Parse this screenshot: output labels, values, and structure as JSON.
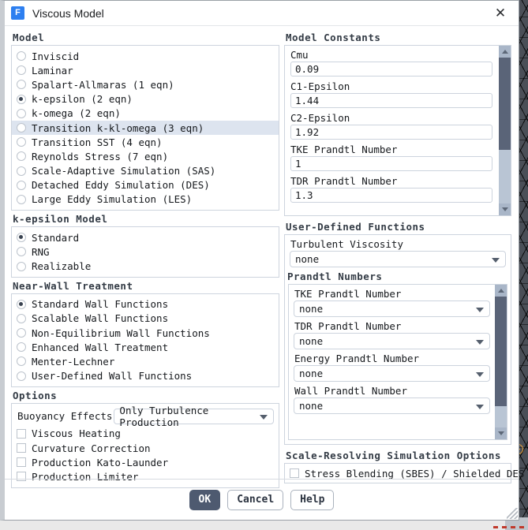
{
  "window": {
    "title": "Viscous Model",
    "app_icon": "fluent-f-icon",
    "icon_letter": "F",
    "close_label": "✕"
  },
  "colors": {
    "accent_primary": "#4e5a70",
    "highlight_row": "#dde4ef",
    "scroll_thumb": "#5a6478",
    "scroll_track": "#b9c5d4",
    "app_icon_blue": "#2d7ff0"
  },
  "model": {
    "title": "Model",
    "options": [
      {
        "label": "Inviscid",
        "selected": false,
        "highlighted": false
      },
      {
        "label": "Laminar",
        "selected": false,
        "highlighted": false
      },
      {
        "label": "Spalart-Allmaras (1 eqn)",
        "selected": false,
        "highlighted": false
      },
      {
        "label": "k-epsilon (2 eqn)",
        "selected": true,
        "highlighted": false
      },
      {
        "label": "k-omega (2 eqn)",
        "selected": false,
        "highlighted": false
      },
      {
        "label": "Transition k-kl-omega (3 eqn)",
        "selected": false,
        "highlighted": true
      },
      {
        "label": "Transition SST (4 eqn)",
        "selected": false,
        "highlighted": false
      },
      {
        "label": "Reynolds Stress (7 eqn)",
        "selected": false,
        "highlighted": false
      },
      {
        "label": "Scale-Adaptive Simulation (SAS)",
        "selected": false,
        "highlighted": false
      },
      {
        "label": "Detached Eddy Simulation (DES)",
        "selected": false,
        "highlighted": false
      },
      {
        "label": "Large Eddy Simulation (LES)",
        "selected": false,
        "highlighted": false
      }
    ]
  },
  "k_epsilon_model": {
    "title": "k-epsilon Model",
    "options": [
      {
        "label": "Standard",
        "selected": true
      },
      {
        "label": "RNG",
        "selected": false
      },
      {
        "label": "Realizable",
        "selected": false
      }
    ]
  },
  "near_wall_treatment": {
    "title": "Near-Wall Treatment",
    "options": [
      {
        "label": "Standard Wall Functions",
        "selected": true
      },
      {
        "label": "Scalable Wall Functions",
        "selected": false
      },
      {
        "label": "Non-Equilibrium Wall Functions",
        "selected": false
      },
      {
        "label": "Enhanced Wall Treatment",
        "selected": false
      },
      {
        "label": "Menter-Lechner",
        "selected": false
      },
      {
        "label": "User-Defined Wall Functions",
        "selected": false
      }
    ]
  },
  "options": {
    "title": "Options",
    "buoyancy_label": "Buoyancy Effects",
    "buoyancy_value": "Only Turbulence Production",
    "checkboxes": [
      {
        "label": "Viscous Heating",
        "checked": false
      },
      {
        "label": "Curvature Correction",
        "checked": false
      },
      {
        "label": "Production Kato-Launder",
        "checked": false
      },
      {
        "label": "Production Limiter",
        "checked": false
      }
    ]
  },
  "model_constants": {
    "title": "Model Constants",
    "fields": [
      {
        "label": "Cmu",
        "value": "0.09"
      },
      {
        "label": "C1-Epsilon",
        "value": "1.44"
      },
      {
        "label": "C2-Epsilon",
        "value": "1.92"
      },
      {
        "label": "TKE Prandtl Number",
        "value": "1"
      },
      {
        "label": "TDR Prandtl Number",
        "value": "1.3"
      }
    ]
  },
  "user_defined_functions": {
    "title": "User-Defined Functions",
    "turbulent_viscosity_label": "Turbulent Viscosity",
    "turbulent_viscosity_value": "none"
  },
  "prandtl_numbers": {
    "title": "Prandtl Numbers",
    "fields": [
      {
        "label": "TKE Prandtl Number",
        "value": "none"
      },
      {
        "label": "TDR Prandtl Number",
        "value": "none"
      },
      {
        "label": "Energy Prandtl Number",
        "value": "none"
      },
      {
        "label": "Wall Prandtl Number",
        "value": "none"
      }
    ]
  },
  "scale_resolving": {
    "title": "Scale-Resolving Simulation Options",
    "checkbox_label": "Stress Blending (SBES) / Shielded DES",
    "checked": false
  },
  "footer": {
    "ok": "OK",
    "cancel": "Cancel",
    "help": "Help"
  }
}
